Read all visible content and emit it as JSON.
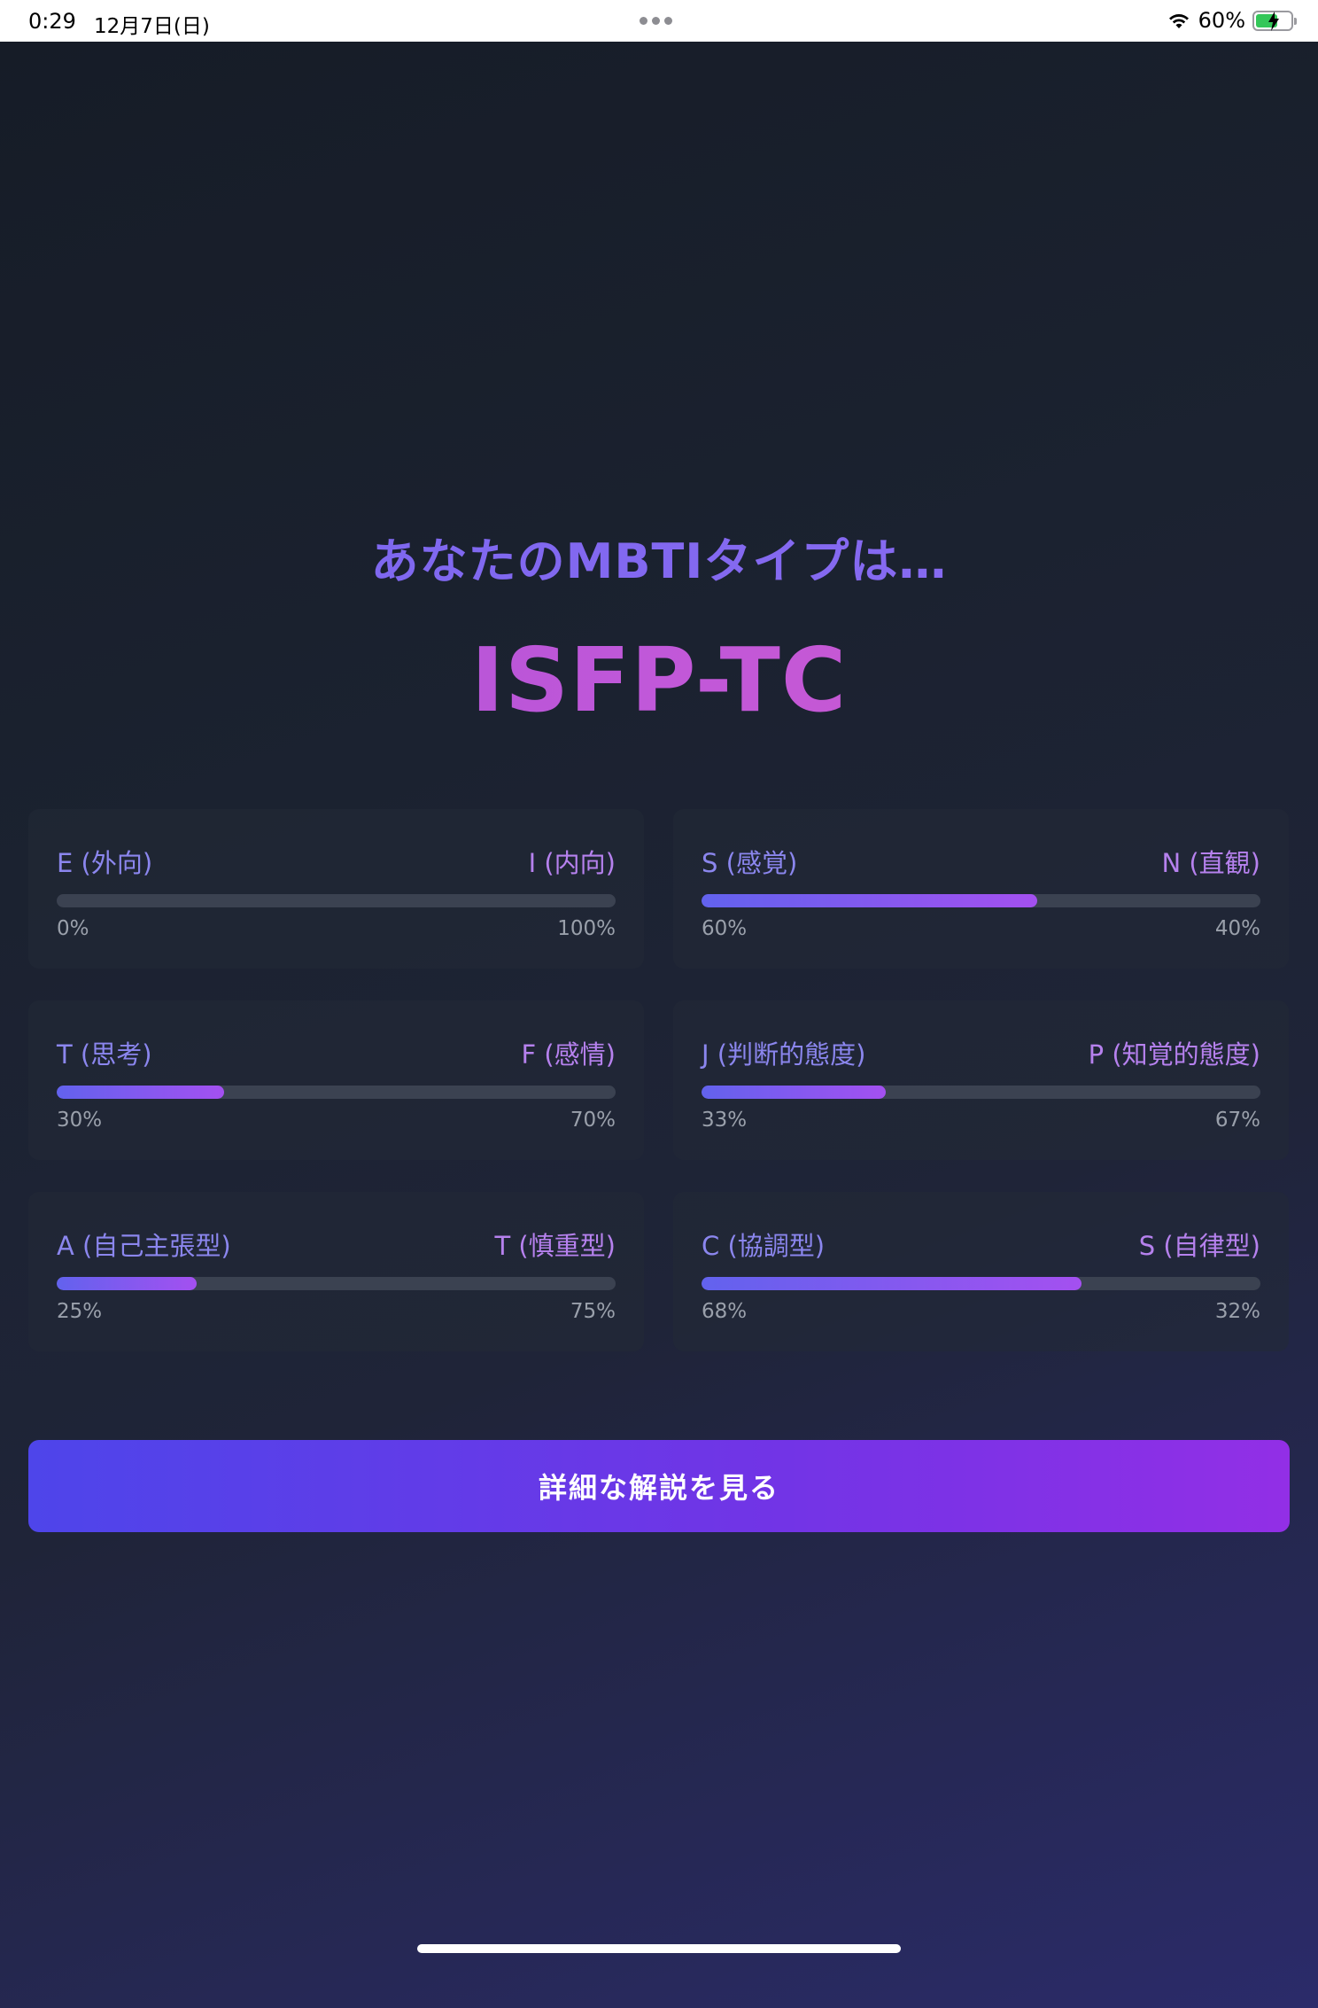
{
  "status_bar": {
    "time": "0:29",
    "date": "12月7日(日)",
    "battery": "60%",
    "battery_level": 0.6
  },
  "result": {
    "subtitle": "あなたのMBTIタイプは…",
    "type_code": "ISFP-TC"
  },
  "dimensions": [
    {
      "left_label": "E (外向)",
      "right_label": "I (内向)",
      "left_pct": "0%",
      "right_pct": "100%",
      "value": 0
    },
    {
      "left_label": "S (感覚)",
      "right_label": "N (直観)",
      "left_pct": "60%",
      "right_pct": "40%",
      "value": 60
    },
    {
      "left_label": "T (思考)",
      "right_label": "F (感情)",
      "left_pct": "30%",
      "right_pct": "70%",
      "value": 30
    },
    {
      "left_label": "J (判断的態度)",
      "right_label": "P (知覚的態度)",
      "left_pct": "33%",
      "right_pct": "67%",
      "value": 33
    },
    {
      "left_label": "A (自己主張型)",
      "right_label": "T (慎重型)",
      "left_pct": "25%",
      "right_pct": "75%",
      "value": 25
    },
    {
      "left_label": "C (協調型)",
      "right_label": "S (自律型)",
      "left_pct": "68%",
      "right_pct": "32%",
      "value": 68
    }
  ],
  "cta": {
    "label": "詳細な解説を見る"
  },
  "colors": {
    "accent_start": "#4e45ea",
    "accent_end": "#922fe6",
    "type_code": "#c158d9"
  }
}
